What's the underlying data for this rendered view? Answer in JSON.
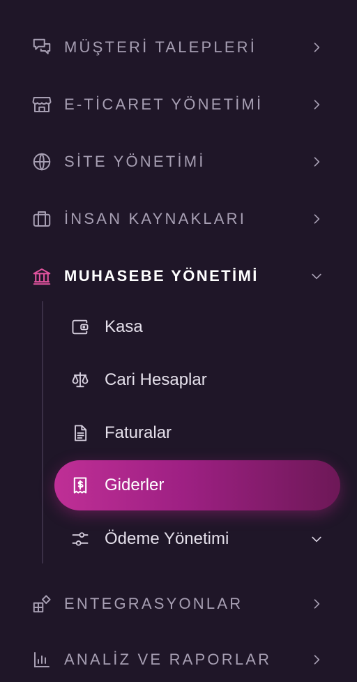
{
  "sidebar": {
    "sections": [
      {
        "label": "MÜŞTERİ TALEPLERİ",
        "icon": "chat-bubbles-icon"
      },
      {
        "label": "E-TİCARET YÖNETİMİ",
        "icon": "storefront-icon"
      },
      {
        "label": "SİTE YÖNETİMİ",
        "icon": "globe-icon"
      },
      {
        "label": "İNSAN KAYNAKLARI",
        "icon": "briefcase-icon"
      },
      {
        "label": "MUHASEBE YÖNETİMİ",
        "icon": "bank-icon",
        "expanded": true
      },
      {
        "label": "ENTEGRASYONLAR",
        "icon": "puzzle-blocks-icon"
      },
      {
        "label": "ANALİZ VE RAPORLAR",
        "icon": "bar-chart-icon"
      }
    ],
    "muhasebe_items": [
      {
        "label": "Kasa",
        "icon": "wallet-icon"
      },
      {
        "label": "Cari Hesaplar",
        "icon": "scale-icon"
      },
      {
        "label": "Faturalar",
        "icon": "document-icon"
      },
      {
        "label": "Giderler",
        "icon": "receipt-dollar-icon",
        "selected": true
      },
      {
        "label": "Ödeme Yönetimi",
        "icon": "sliders-icon",
        "has_submenu": true
      }
    ]
  },
  "colors": {
    "background": "#1f1628",
    "muted_text": "#a79fb3",
    "active_accent": "#e0539e",
    "selected_gradient_start": "#bf2f96",
    "selected_gradient_end": "#6d1857"
  }
}
